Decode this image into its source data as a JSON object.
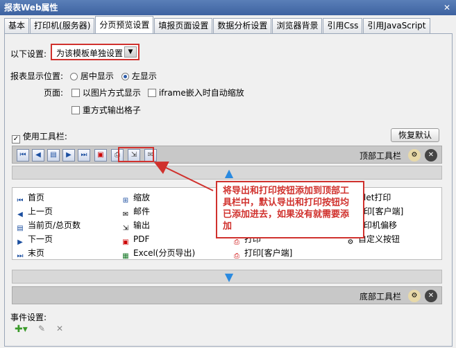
{
  "window": {
    "title": "报表Web属性",
    "close": "✕"
  },
  "tabs": [
    "基本",
    "打印机(服务器)",
    "分页预览设置",
    "填报页面设置",
    "数据分析设置",
    "浏览器背景",
    "引用Css",
    "引用JavaScript"
  ],
  "settings": {
    "scope_label": "以下设置:",
    "scope_value": "为该模板单独设置",
    "position_label": "报表显示位置:",
    "center_label": "居中显示",
    "left_label": "左显示",
    "page_label": "页面:",
    "image_label": "以图片方式显示",
    "iframe_label": "iframe嵌入时自动缩放",
    "repeat_label": "重方式输出格子",
    "toolbar_label": "使用工具栏:",
    "restore_label": "恢复默认"
  },
  "top_toolbar": {
    "label": "顶部工具栏"
  },
  "bottom_toolbar": {
    "label": "底部工具栏"
  },
  "items": {
    "col1": [
      "首页",
      "上一页",
      "当前页/总页数",
      "下一页",
      "末页"
    ],
    "col2": [
      "缩放",
      "邮件",
      "输出",
      "PDF",
      "Excel(分页导出)"
    ],
    "col3": [
      "",
      "",
      "",
      "打印",
      "打印[客户端]"
    ],
    "col4": [
      "let打印",
      "印[客户端]",
      "印机偏移",
      "自定义按钮",
      ""
    ]
  },
  "callout": "将导出和打印按钮添加到顶部工具栏中，默认导出和打印按钮均已添加进去，如果没有就需要添加",
  "events": {
    "label": "事件设置:"
  }
}
